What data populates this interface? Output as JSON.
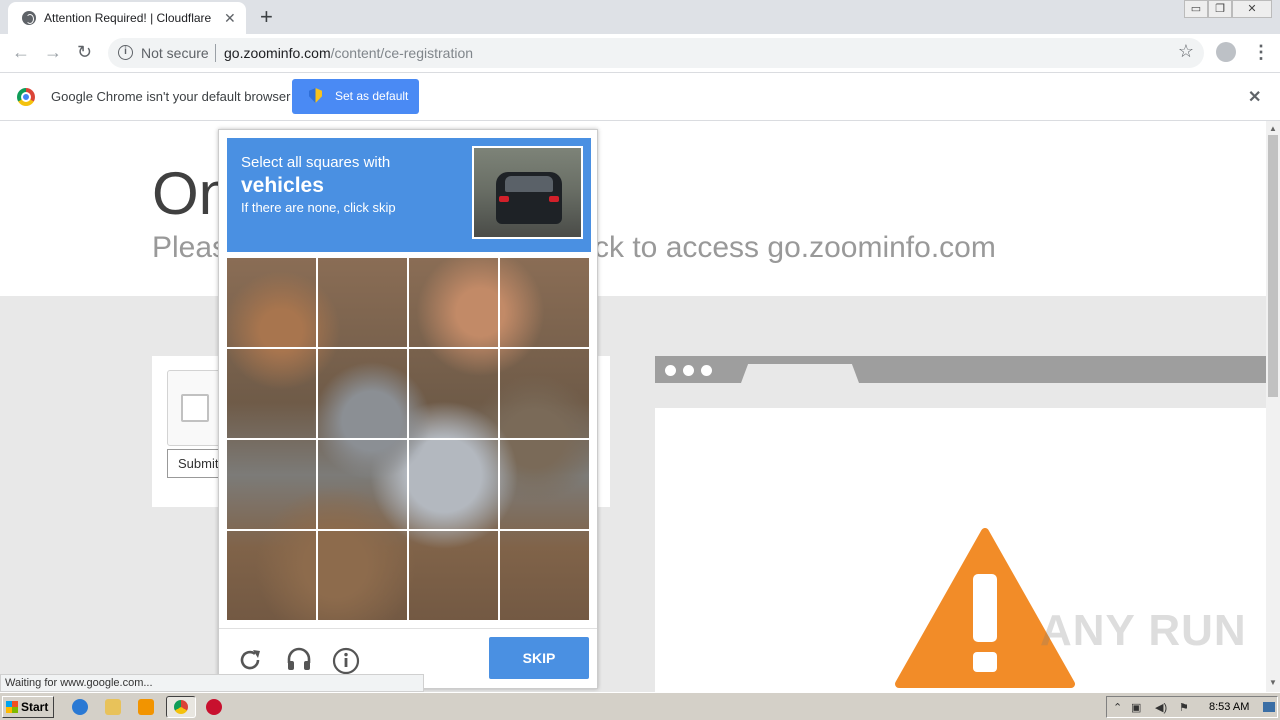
{
  "browser": {
    "tab_title": "Attention Required! | Cloudflare",
    "address": {
      "security_label": "Not secure",
      "host": "go.zoominfo.com",
      "path": "/content/ce-registration"
    }
  },
  "infobar": {
    "message": "Google Chrome isn't your default browser",
    "default_button": "Set as default"
  },
  "page": {
    "title_fragment": "On",
    "subtitle_start": "Pleas",
    "subtitle_end": "ck to access go.zoominfo.com",
    "submit_label": "Submit"
  },
  "challenge": {
    "line1": "Select all squares with",
    "line2": "vehicles",
    "line3": "If there are none, click skip",
    "skip_label": "SKIP",
    "tiles": 16
  },
  "status": {
    "text": "Waiting for www.google.com..."
  },
  "watermark": "ANY RUN",
  "taskbar": {
    "start_label": "Start",
    "clock": "8:53 AM"
  },
  "colors": {
    "accent": "#4a90e2",
    "warning": "#f28c28"
  }
}
